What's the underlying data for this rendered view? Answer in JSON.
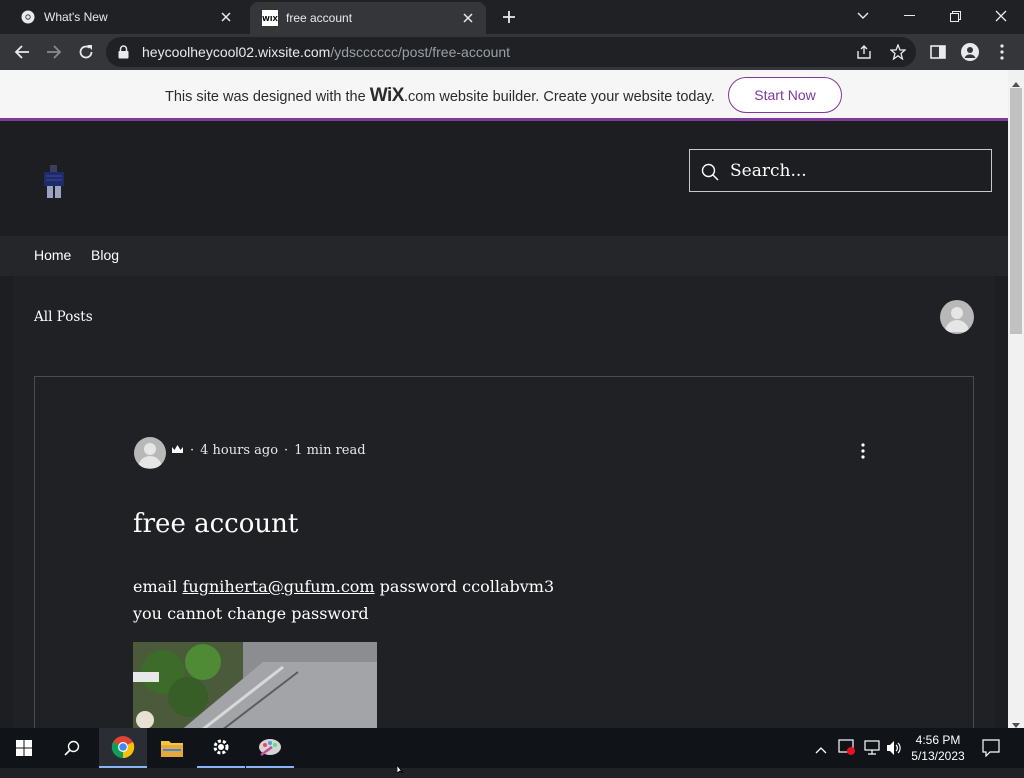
{
  "browser": {
    "tabs": [
      {
        "title": "What's New",
        "active": false
      },
      {
        "title": "free account",
        "active": true
      }
    ],
    "url_host": "heycoolheycool02.wixsite.com",
    "url_path": "/ydscccccc/post/free-account"
  },
  "wix_banner": {
    "text_before": "This site was designed with the ",
    "brand": "WiX",
    "text_after": ".com website builder. Create your website today.",
    "cta": "Start Now"
  },
  "site": {
    "search_placeholder": "Search...",
    "nav": [
      "Home",
      "Blog"
    ],
    "all_posts": "All Posts"
  },
  "post": {
    "time_ago": "4 hours ago",
    "read_time": "1 min read",
    "separator": "·",
    "title": "free account",
    "body_prefix": "email ",
    "email": "fugniherta@gufum.com",
    "body_mid": " password ccollabvm3",
    "body_line2": "you cannot change password"
  },
  "taskbar": {
    "time": "4:56 PM",
    "date": "5/13/2023"
  },
  "colors": {
    "wix_accent": "#80399b",
    "site_bg": "#1d1e22",
    "browser_bg": "#202124"
  }
}
